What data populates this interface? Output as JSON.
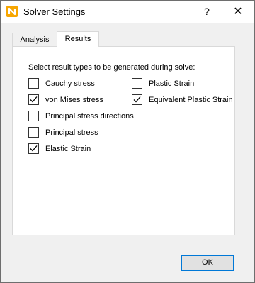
{
  "window": {
    "title": "Solver Settings",
    "help_label": "?",
    "close_label": "✕"
  },
  "tabs": [
    {
      "label": "Analysis",
      "selected": false
    },
    {
      "label": "Results",
      "selected": true
    }
  ],
  "results": {
    "group_label": "Select result types to be generated during solve:",
    "options": [
      {
        "label": "Cauchy stress",
        "checked": false
      },
      {
        "label": "von Mises stress",
        "checked": true
      },
      {
        "label": "Principal stress directions",
        "checked": false
      },
      {
        "label": "Principal stress",
        "checked": false
      },
      {
        "label": "Elastic Strain",
        "checked": true
      },
      {
        "label": "Plastic Strain",
        "checked": false
      },
      {
        "label": "Equivalent Plastic Strain",
        "checked": true
      }
    ]
  },
  "footer": {
    "ok_label": "OK"
  },
  "colors": {
    "accent": "#0078d7",
    "app_icon": "#f7a600"
  }
}
